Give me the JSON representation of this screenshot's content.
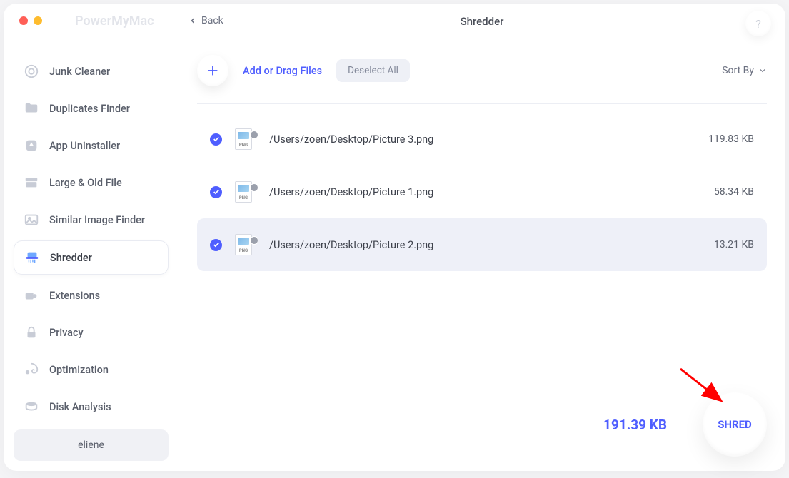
{
  "brand": "PowerMyMac",
  "back_label": "Back",
  "page_title": "Shredder",
  "help_label": "?",
  "toolbar": {
    "add_label": "Add or Drag Files",
    "deselect_label": "Deselect All",
    "sort_label": "Sort By"
  },
  "sidebar": {
    "items": [
      {
        "label": "Junk Cleaner",
        "icon": "target-icon"
      },
      {
        "label": "Duplicates Finder",
        "icon": "folder-icon"
      },
      {
        "label": "App Uninstaller",
        "icon": "app-icon"
      },
      {
        "label": "Large & Old File",
        "icon": "archive-icon"
      },
      {
        "label": "Similar Image Finder",
        "icon": "image-icon"
      },
      {
        "label": "Shredder",
        "icon": "shredder-icon"
      },
      {
        "label": "Extensions",
        "icon": "puzzle-icon"
      },
      {
        "label": "Privacy",
        "icon": "lock-icon"
      },
      {
        "label": "Optimization",
        "icon": "swirl-icon"
      },
      {
        "label": "Disk Analysis",
        "icon": "disk-icon"
      }
    ],
    "active_index": 5,
    "user": "eliene"
  },
  "files": [
    {
      "path": "/Users/zoen/Desktop/Picture 3.png",
      "size": "119.83 KB",
      "checked": true,
      "selected": false
    },
    {
      "path": "/Users/zoen/Desktop/Picture 1.png",
      "size": "58.34 KB",
      "checked": true,
      "selected": false
    },
    {
      "path": "/Users/zoen/Desktop/Picture 2.png",
      "size": "13.21 KB",
      "checked": true,
      "selected": true
    }
  ],
  "total_size": "191.39 KB",
  "shred_label": "SHRED"
}
